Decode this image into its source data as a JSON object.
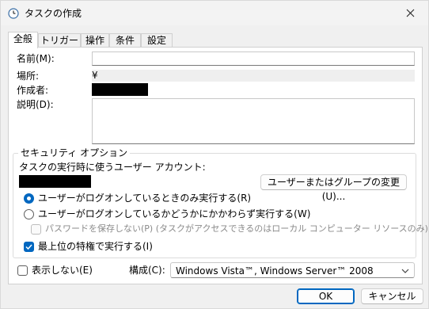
{
  "window": {
    "title": "タスクの作成",
    "icon": "clock-icon",
    "close_icon": "close-icon"
  },
  "tabs": [
    {
      "label": "全般",
      "active": true
    },
    {
      "label": "トリガー",
      "active": false
    },
    {
      "label": "操作",
      "active": false
    },
    {
      "label": "条件",
      "active": false
    },
    {
      "label": "設定",
      "active": false
    }
  ],
  "general": {
    "name_label": "名前(M):",
    "name_value": "",
    "location_label": "場所:",
    "location_value": "¥",
    "author_label": "作成者:",
    "description_label": "説明(D):",
    "description_value": ""
  },
  "security": {
    "group_title": "セキュリティ オプション",
    "account_label": "タスクの実行時に使うユーザー アカウント:",
    "change_user_button": "ユーザーまたはグループの変更(U)...",
    "radio_logged_on": "ユーザーがログオンしているときのみ実行する(R)",
    "radio_whether": "ユーザーがログオンしているかどうかにかかわらず実行する(W)",
    "radio_selected": "logged_on",
    "no_store_password": "パスワードを保存しない(P) (タスクがアクセスできるのはローカル コンピューター リソースのみ)",
    "highest_privileges": "最上位の特権で実行する(I)",
    "highest_privileges_checked": true
  },
  "footer": {
    "hidden_label": "表示しない(E)",
    "hidden_checked": false,
    "configure_label": "構成(C):",
    "configure_value": "Windows Vista™, Windows Server™ 2008",
    "ok_button": "OK",
    "cancel_button": "キャンセル"
  },
  "colors": {
    "accent": "#0067c0",
    "window_bg": "#f0f0f0",
    "panel_bg": "#ffffff"
  }
}
